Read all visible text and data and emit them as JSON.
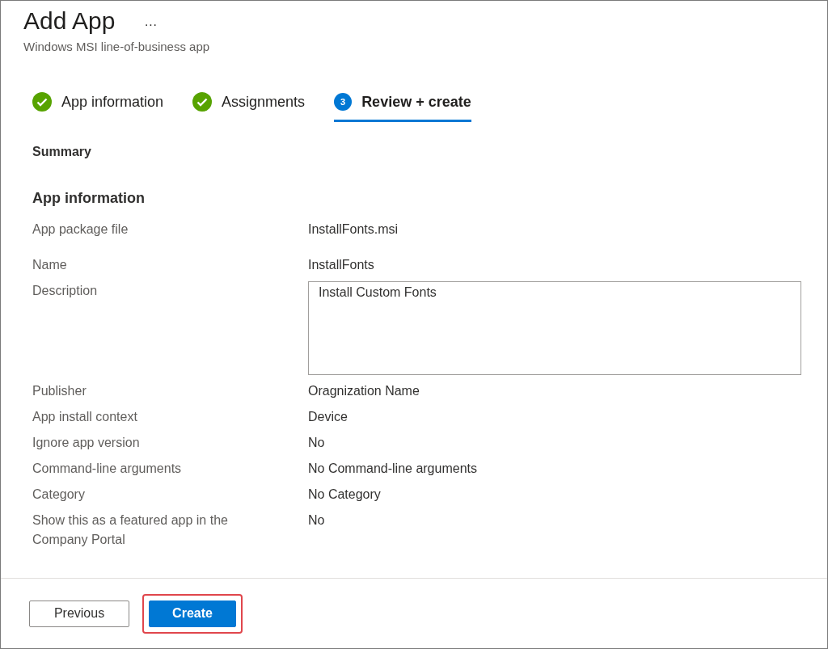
{
  "header": {
    "title": "Add App",
    "more": "···",
    "subtitle": "Windows MSI line-of-business app"
  },
  "steps": [
    {
      "label": "App information",
      "kind": "done",
      "selected": false
    },
    {
      "label": "Assignments",
      "kind": "done",
      "selected": false
    },
    {
      "label": "Review + create",
      "kind": "current",
      "number": "3",
      "selected": true
    }
  ],
  "summary_heading": "Summary",
  "section_heading": "App information",
  "rows": [
    {
      "kind": "text",
      "label": "App package file",
      "value": "InstallFonts.msi"
    },
    {
      "kind": "text",
      "label": "Name",
      "value": "InstallFonts"
    },
    {
      "kind": "textarea",
      "label": "Description",
      "value": "Install Custom Fonts"
    },
    {
      "kind": "text",
      "label": "Publisher",
      "value": "Oragnization Name"
    },
    {
      "kind": "text",
      "label": "App install context",
      "value": "Device"
    },
    {
      "kind": "text",
      "label": "Ignore app version",
      "value": "No"
    },
    {
      "kind": "text",
      "label": "Command-line arguments",
      "value": "No Command-line arguments"
    },
    {
      "kind": "text",
      "label": "Category",
      "value": "No Category"
    },
    {
      "kind": "text",
      "label": "Show this as a featured app in the Company Portal",
      "value": "No"
    }
  ],
  "footer": {
    "buttons": [
      {
        "label": "Previous",
        "kind": "secondary",
        "highlighted": false
      },
      {
        "label": "Create",
        "kind": "primary",
        "highlighted": true
      }
    ]
  }
}
